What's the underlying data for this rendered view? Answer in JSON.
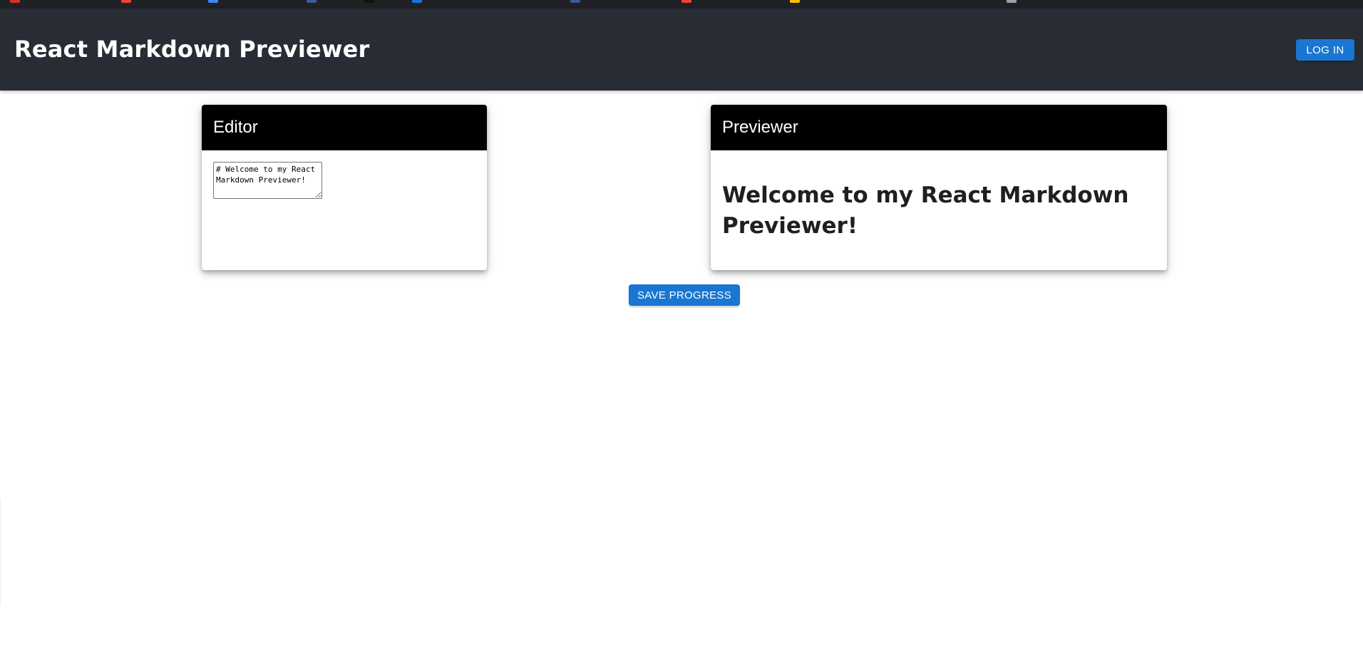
{
  "header": {
    "title": "React Markdown Previewer",
    "login_label": "LOG IN"
  },
  "editor": {
    "title": "Editor",
    "value": "# Welcome to my React Markdown Previewer!"
  },
  "previewer": {
    "title": "Previewer",
    "heading": "Welcome to my React Markdown Previewer!"
  },
  "actions": {
    "save_label": "SAVE PROGRESS"
  },
  "colors": {
    "app_bar": "#282c34",
    "card_header": "#000000",
    "primary": "#1976d2"
  }
}
